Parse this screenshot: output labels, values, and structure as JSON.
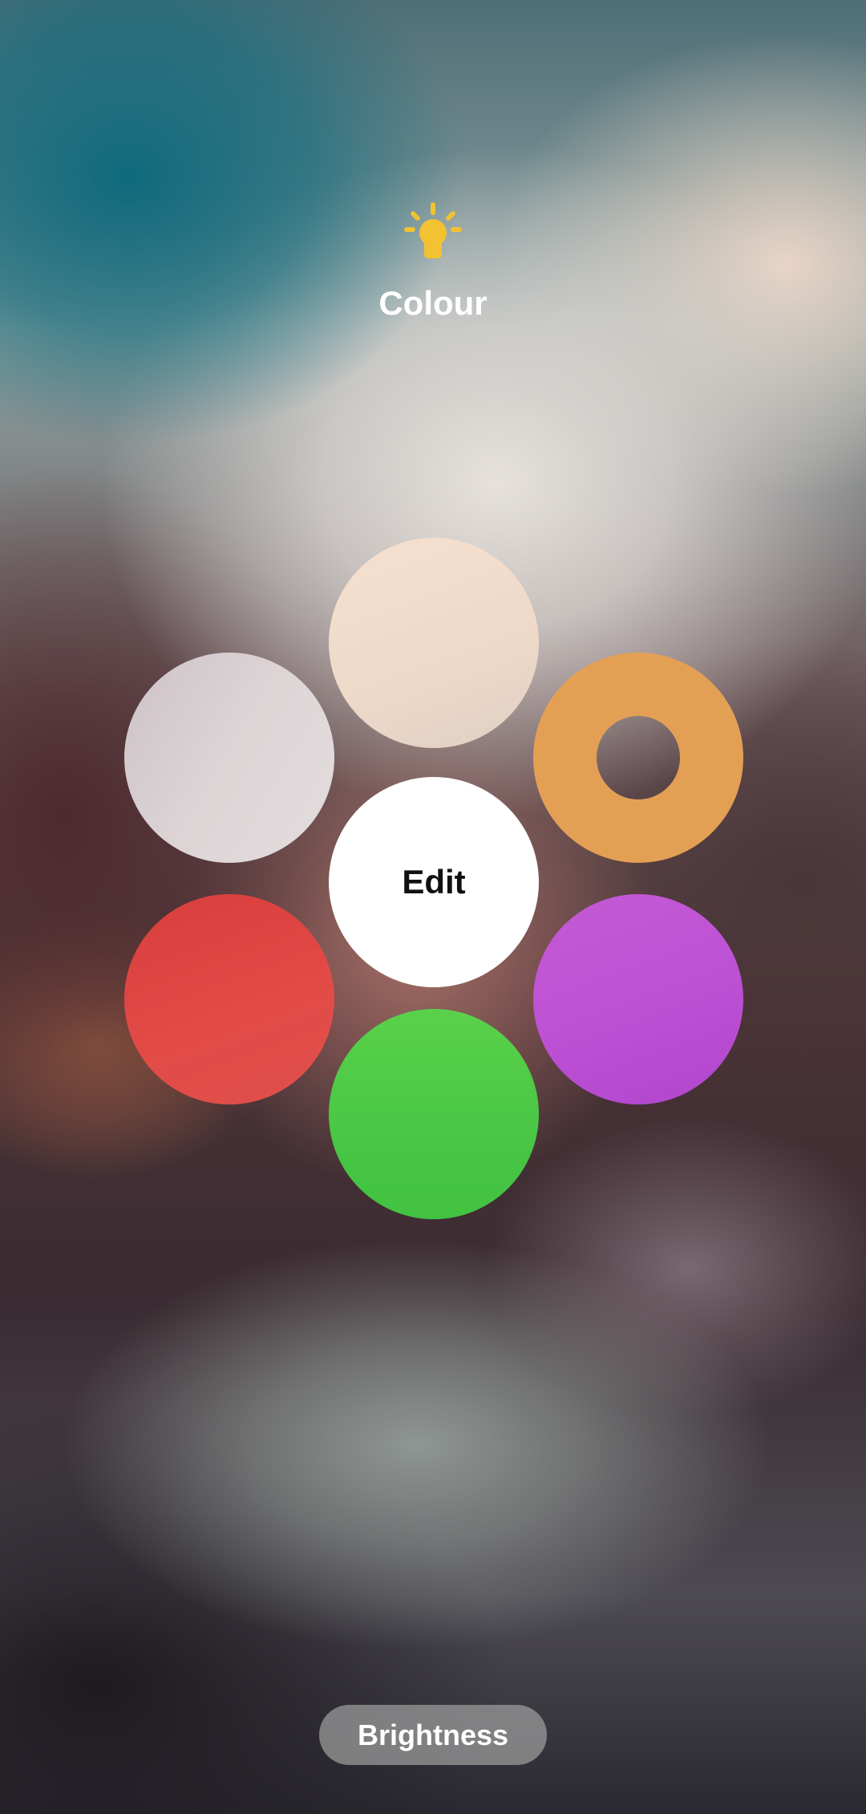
{
  "header": {
    "icon": "lightbulb-icon",
    "icon_color": "#f2c232",
    "title": "Colour"
  },
  "swatches": [
    {
      "name": "peach",
      "color": "#f3decf"
    },
    {
      "name": "lavender",
      "color": "#d8cfd1"
    },
    {
      "name": "orange",
      "color": "#e3a055",
      "selected": true
    },
    {
      "name": "edit",
      "color": "#ffffff",
      "label": "Edit"
    },
    {
      "name": "red",
      "color": "#e04844"
    },
    {
      "name": "purple",
      "color": "#bf52d4"
    },
    {
      "name": "green",
      "color": "#49c745"
    }
  ],
  "footer": {
    "brightness_label": "Brightness"
  }
}
